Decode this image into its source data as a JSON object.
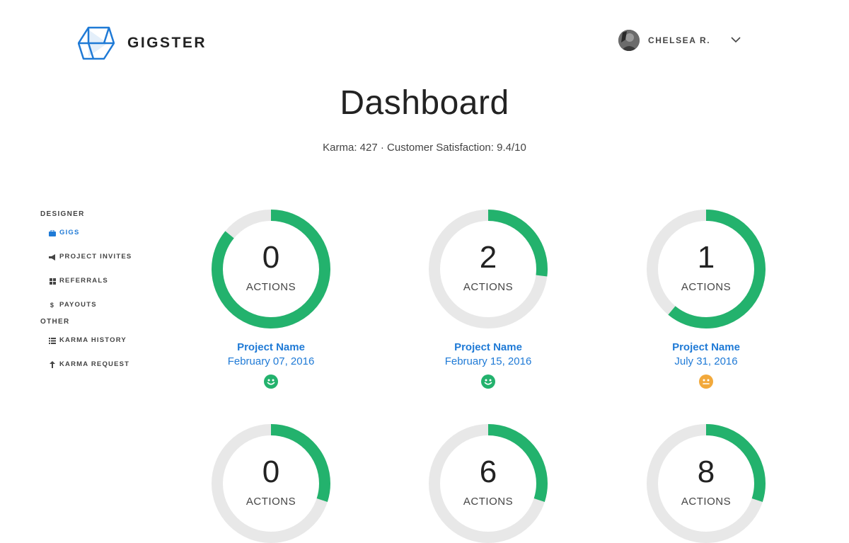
{
  "header": {
    "brand": "GIGSTER",
    "user_name": "CHELSEA R."
  },
  "page": {
    "title": "Dashboard",
    "stats": "Karma: 427 · Customer Satisfaction: 9.4/10"
  },
  "sidebar": {
    "sections": [
      {
        "heading": "DESIGNER",
        "items": [
          {
            "label": "GIGS",
            "icon": "briefcase-icon",
            "active": true
          },
          {
            "label": "PROJECT INVITES",
            "icon": "megaphone-icon",
            "active": false
          },
          {
            "label": "REFERRALS",
            "icon": "grid-icon",
            "active": false
          },
          {
            "label": "PAYOUTS",
            "icon": "dollar-icon",
            "active": false
          }
        ]
      },
      {
        "heading": "OTHER",
        "items": [
          {
            "label": "KARMA HISTORY",
            "icon": "list-icon",
            "active": false
          },
          {
            "label": "KARMA REQUEST",
            "icon": "arrow-up-icon",
            "active": false
          }
        ]
      }
    ]
  },
  "gigs": [
    {
      "actions": "0",
      "actions_label": "ACTIONS",
      "progress": 0.86,
      "project_name": "Project Name",
      "date": "February 07, 2016",
      "mood": "happy"
    },
    {
      "actions": "2",
      "actions_label": "ACTIONS",
      "progress": 0.27,
      "project_name": "Project Name",
      "date": "February 15, 2016",
      "mood": "happy"
    },
    {
      "actions": "1",
      "actions_label": "ACTIONS",
      "progress": 0.61,
      "project_name": "Project Name",
      "date": "July 31, 2016",
      "mood": "neutral"
    },
    {
      "actions": "0",
      "actions_label": "ACTIONS",
      "progress": 0.3,
      "project_name": "",
      "date": "",
      "mood": ""
    },
    {
      "actions": "6",
      "actions_label": "ACTIONS",
      "progress": 0.3,
      "project_name": "",
      "date": "",
      "mood": ""
    },
    {
      "actions": "8",
      "actions_label": "ACTIONS",
      "progress": 0.3,
      "project_name": "",
      "date": "",
      "mood": ""
    }
  ],
  "colors": {
    "ring_fill": "#23b26d",
    "ring_track": "#e8e8e8",
    "link_blue": "#1f7ad6",
    "mood_happy": "#23b26d",
    "mood_neutral": "#f2a93b",
    "logo_blue": "#1f7ad6"
  }
}
